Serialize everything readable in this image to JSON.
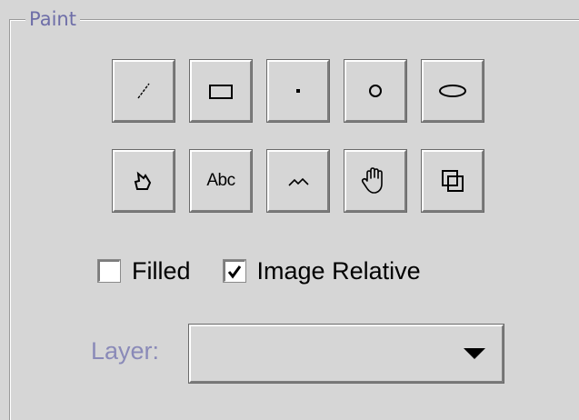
{
  "panel": {
    "title": "Paint"
  },
  "tools": {
    "row1": [
      {
        "name": "line",
        "icon": "line-icon"
      },
      {
        "name": "rectangle",
        "icon": "rectangle-icon"
      },
      {
        "name": "point",
        "icon": "point-icon"
      },
      {
        "name": "circle",
        "icon": "circle-icon"
      },
      {
        "name": "ellipse",
        "icon": "ellipse-icon"
      }
    ],
    "row2": [
      {
        "name": "polygon",
        "icon": "polygon-icon"
      },
      {
        "name": "text",
        "icon": "text-icon",
        "label": "Abc"
      },
      {
        "name": "polyline",
        "icon": "polyline-icon"
      },
      {
        "name": "pan",
        "icon": "hand-icon"
      },
      {
        "name": "layers",
        "icon": "overlap-squares-icon"
      }
    ]
  },
  "options": {
    "filled": {
      "label": "Filled",
      "checked": false
    },
    "image_relative": {
      "label": "Image Relative",
      "checked": true
    }
  },
  "layer": {
    "label": "Layer:",
    "selected": "",
    "arrow_icon": "dropdown-arrow-icon"
  },
  "colors": {
    "background": "#d6d6d6",
    "title_text": "#6e6ea8",
    "layer_label_text": "#8a8ab8"
  }
}
